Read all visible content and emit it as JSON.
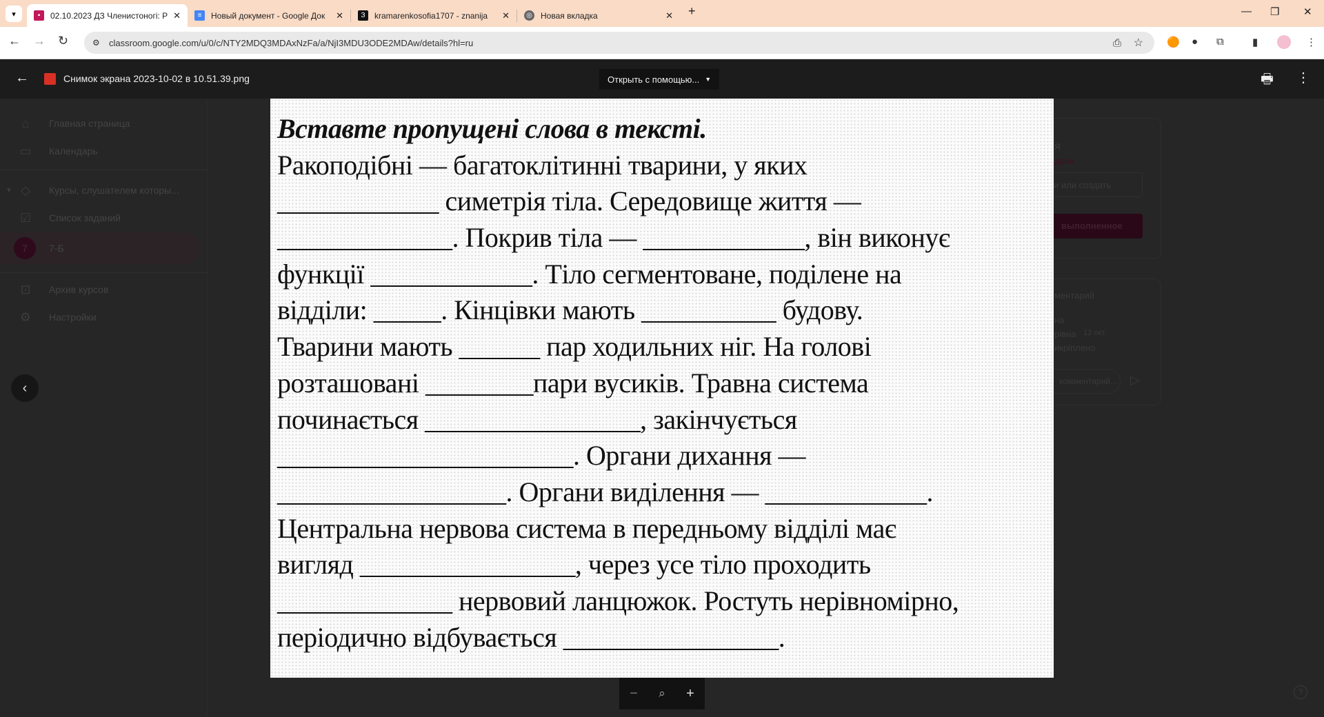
{
  "browser": {
    "tabs": [
      {
        "title": "02.10.2023 ДЗ Членистоногі: Р",
        "icon": "classroom-icon",
        "active": true
      },
      {
        "title": "Новый документ - Google Док",
        "icon": "docs-icon",
        "active": false
      },
      {
        "title": "kramarenkosofia1707 - znanija",
        "icon": "znanija-icon",
        "active": false
      },
      {
        "title": "Новая вкладка",
        "icon": "chrome-icon",
        "active": false
      }
    ],
    "new_tab": "+",
    "url": "classroom.google.com/u/0/c/NTY2MDQ3MDAxNzFa/a/NjI3MDU3ODE2MDAw/details?hl=ru"
  },
  "viewer": {
    "file_name": "Снимок экрана 2023-10-02 в 10.51.39.png",
    "open_with": "Открыть с помощью...",
    "zoom": {
      "minus": "−",
      "plus": "+"
    }
  },
  "sidebar": {
    "items": [
      {
        "label": "Главная страница",
        "icon": "home-icon"
      },
      {
        "label": "Календарь",
        "icon": "calendar-icon"
      },
      {
        "label": "Курсы, слушателем которы...",
        "icon": "school-icon"
      },
      {
        "label": "Список заданий",
        "icon": "task-list-icon"
      },
      {
        "label": "7-Б",
        "icon": "class-avatar",
        "avatar": "7"
      },
      {
        "label": "Архив курсов",
        "icon": "archive-icon"
      },
      {
        "label": "Настройки",
        "icon": "settings-icon"
      }
    ]
  },
  "right_panel": {
    "title_fragment": "я",
    "status_fragment": "дачи",
    "add_fragment": "и или создать",
    "submit_fragment": "выполненное",
    "comments_fragment": "ментарий",
    "author_fragment_1": "на",
    "author_fragment_2": "рівна",
    "date": "12 окт.",
    "attached_fragment": "икріплено",
    "comment_placeholder": "комментарий..."
  },
  "document": {
    "title": "Вставте пропущені слова в тексті.",
    "lines": [
      "Ракоподібні — багатоклітинні тварини, у яких",
      "____________ симетрія тіла. Середовище життя —",
      "_____________. Покрив тіла — ____________, він виконує",
      "функції ____________. Тіло сегментоване, поділене на",
      "відділи: _____. Кінцівки мають __________ будову.",
      "Тварини мають ______ пар ходильних ніг. На голові",
      "розташовані ________пари вусиків. Травна система",
      "починається ________________, закінчується",
      "______________________. Органи дихання —",
      "_________________. Органи виділення — ____________.",
      "Центральна нервова система в передньому відділі має",
      "вигляд ________________, через усе тіло проходить",
      "_____________ нервовий ланцюжок. Ростуть нерівномірно,",
      "періодично відбувається ________________."
    ]
  },
  "colors": {
    "tabbar": "#fadbc6",
    "accent_dark": "#3a0a22",
    "viewer_bg": "#1c1c1c"
  }
}
